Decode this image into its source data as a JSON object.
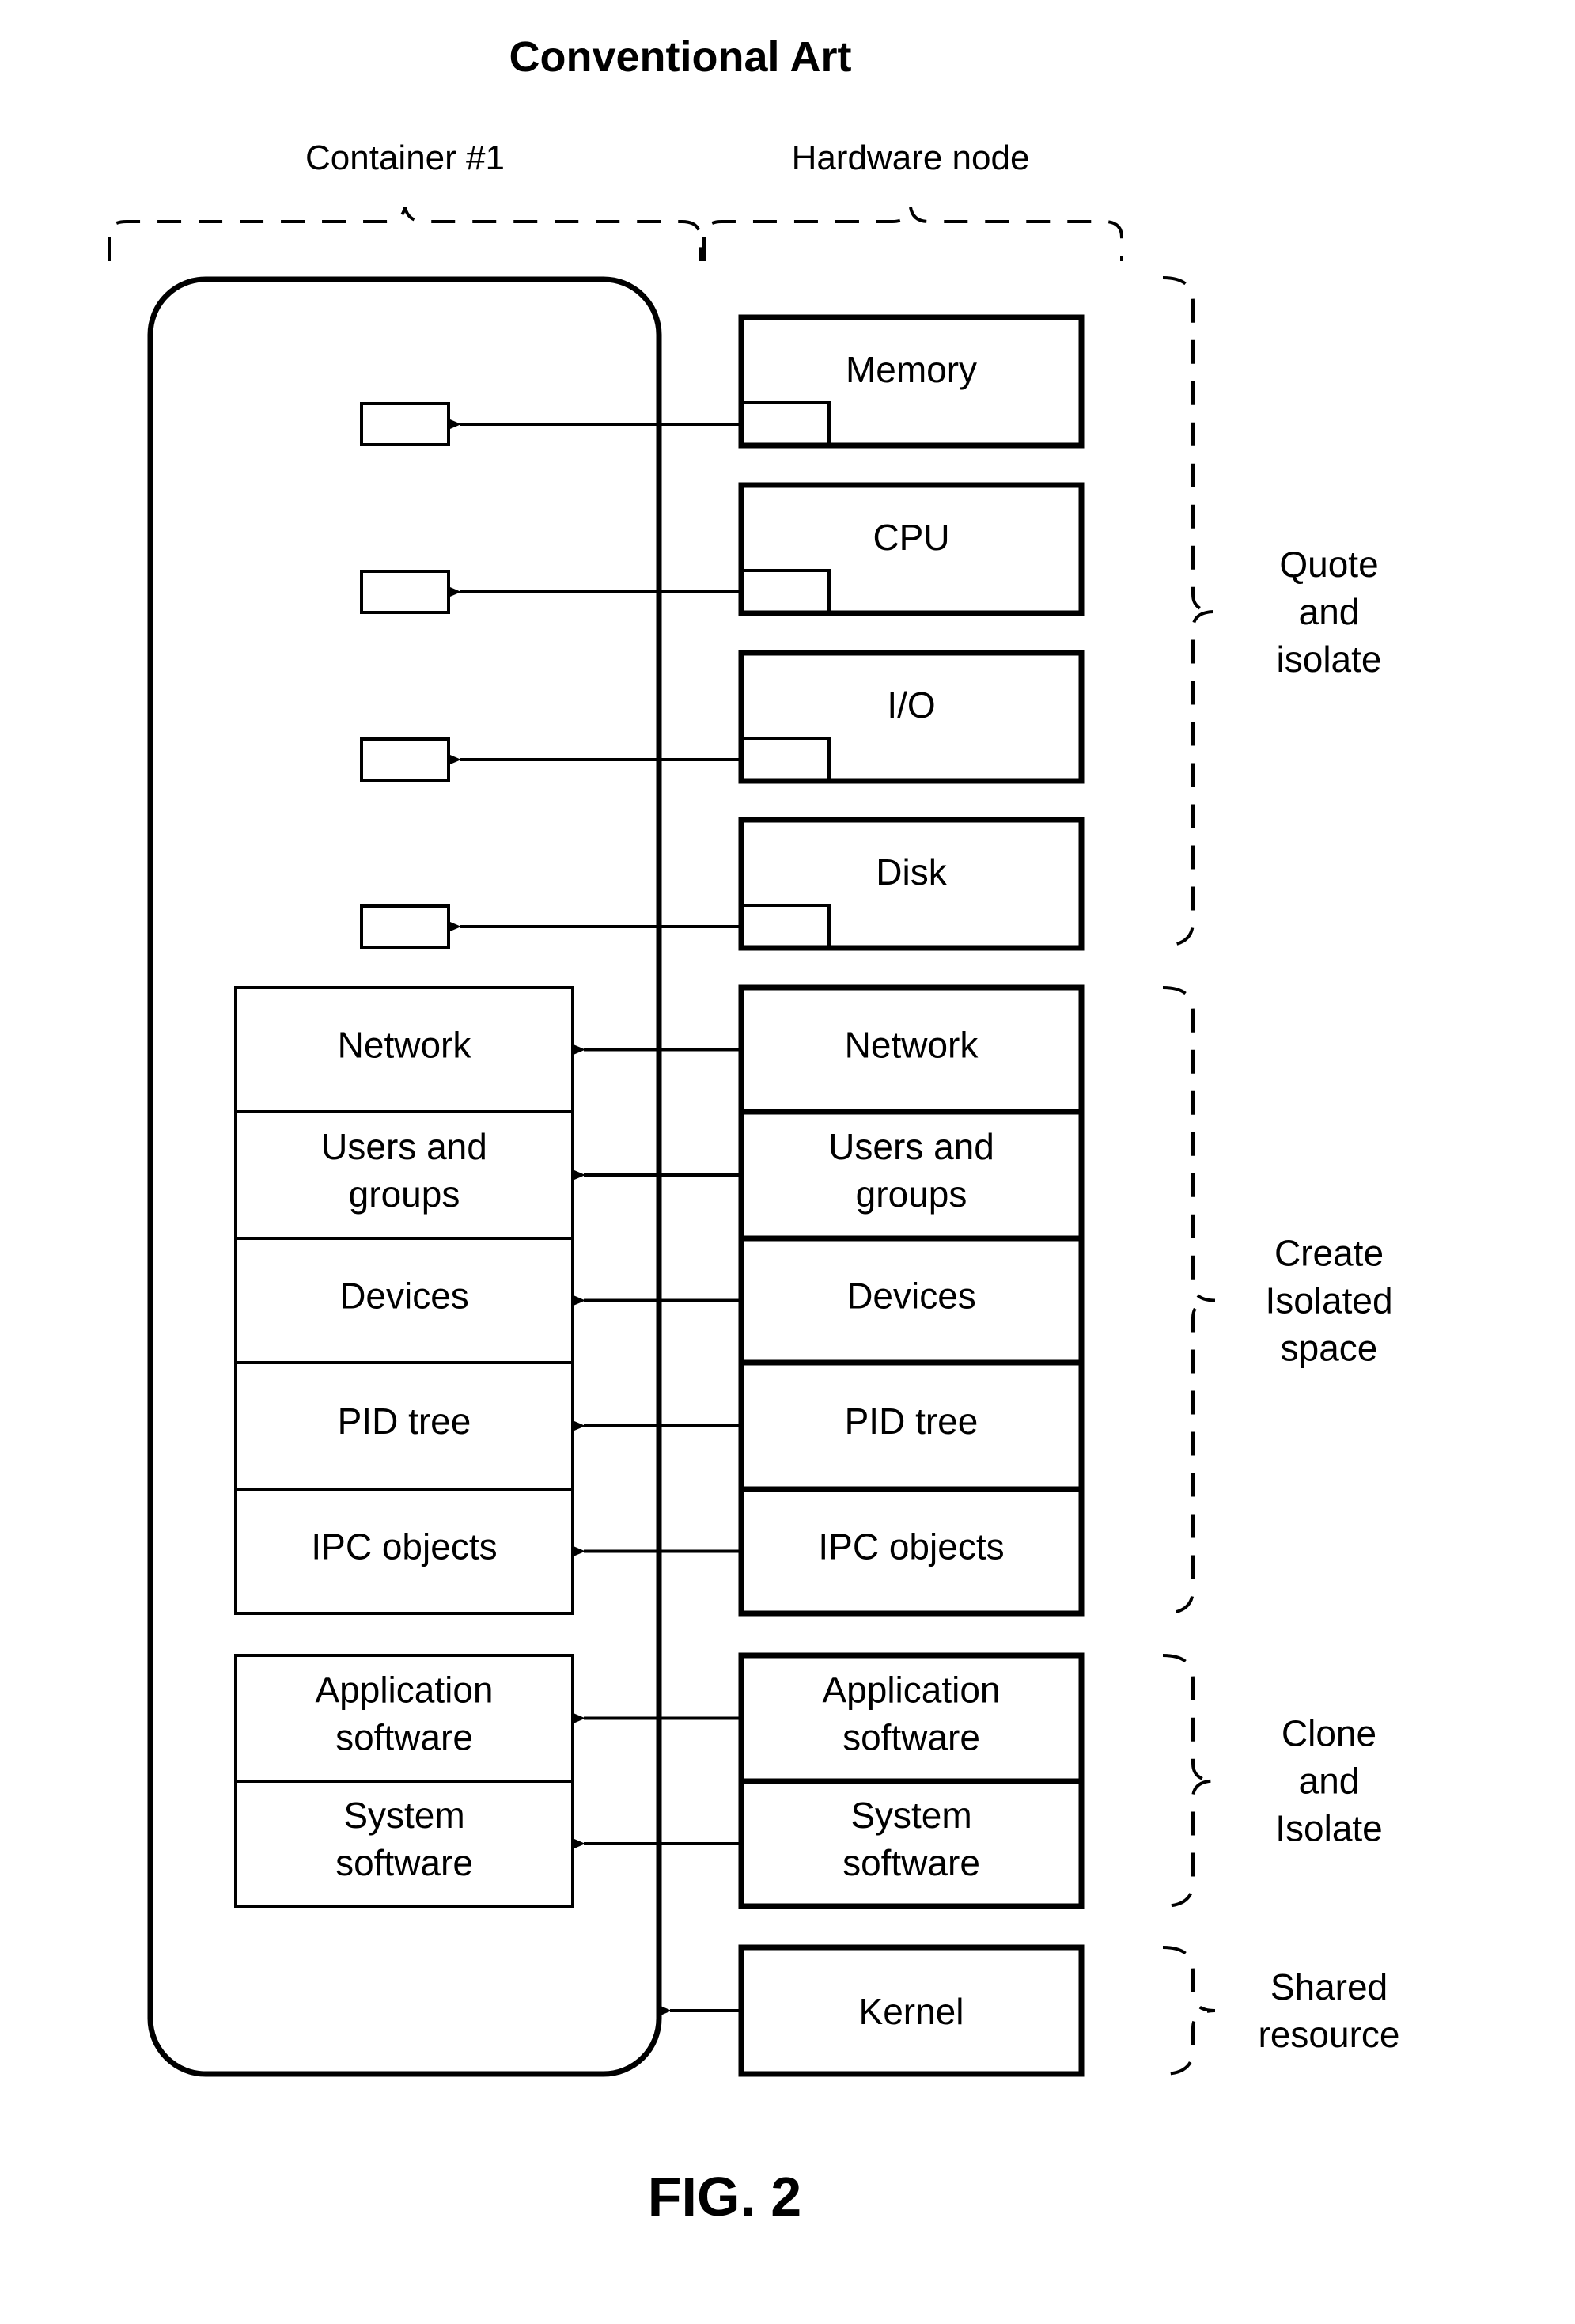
{
  "title": "Conventional Art",
  "figure_label": "FIG. 2",
  "column_headers": {
    "container": "Container #1",
    "hardware_node": "Hardware node"
  },
  "resources": [
    {
      "label": "Memory"
    },
    {
      "label": "CPU"
    },
    {
      "label": "I/O"
    },
    {
      "label": "Disk"
    }
  ],
  "namespaces": [
    {
      "lines": [
        "Network"
      ]
    },
    {
      "lines": [
        "Users and",
        "groups"
      ]
    },
    {
      "lines": [
        "Devices"
      ]
    },
    {
      "lines": [
        "PID tree"
      ]
    },
    {
      "lines": [
        "IPC objects"
      ]
    }
  ],
  "software": [
    {
      "lines": [
        "Application",
        "software"
      ]
    },
    {
      "lines": [
        "System",
        "software"
      ]
    }
  ],
  "kernel": {
    "label": "Kernel"
  },
  "groups": [
    {
      "lines": [
        "Quote",
        "and",
        "isolate"
      ]
    },
    {
      "lines": [
        "Create",
        "Isolated",
        "space"
      ]
    },
    {
      "lines": [
        "Clone",
        "and",
        "Isolate"
      ]
    },
    {
      "lines": [
        "Shared",
        "resource"
      ]
    }
  ]
}
